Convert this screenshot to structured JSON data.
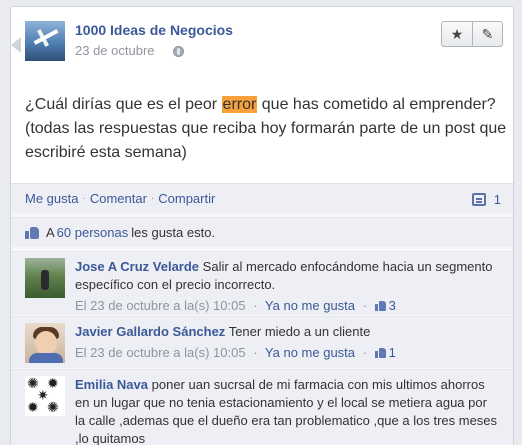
{
  "post": {
    "page_name": "1000 Ideas de Negocios",
    "date": "23 de octubre",
    "text_before": "¿Cuál dirías que es el peor ",
    "text_highlight": "error",
    "text_after": " que has cometido al emprender? (todas las respuestas que reciba hoy formarán parte de un post que escribiré esta semana)",
    "highlight_color": "#f7a13c"
  },
  "actions": {
    "star_icon": "star-icon",
    "edit_icon": "pencil-icon"
  },
  "feedback": {
    "like": "Me gusta",
    "comment": "Comentar",
    "share": "Compartir",
    "comment_count": "1",
    "separator": "·"
  },
  "likes": {
    "prefix": "A ",
    "people_link": "60 personas",
    "suffix": " les gusta esto."
  },
  "comments": [
    {
      "author": "Jose A Cruz Velarde",
      "text": "Salir al mercado enfocándome hacia un segmento específico con el precio incorrecto.",
      "date": "El 23 de octubre a la(s) 10:05",
      "unlike": "Ya no me gusta",
      "like_count": "3"
    },
    {
      "author": "Javier Gallardo Sánchez",
      "text": "Tener miedo a un cliente",
      "date": "El 23 de octubre a la(s) 10:05",
      "unlike": "Ya no me gusta",
      "like_count": "1"
    },
    {
      "author": "Emilia Nava",
      "text": "poner uan sucrsal de mi farmacia con mis ultimos ahorros en un lugar que no tenia estacionamiento y el local se metiera agua por la calle ,ademas que el dueño era tan problematico ,que a los tres meses ,lo quitamos"
    }
  ],
  "colors": {
    "link": "#3b5998",
    "muted": "#90949c",
    "ufi_bg": "#edeff4"
  }
}
